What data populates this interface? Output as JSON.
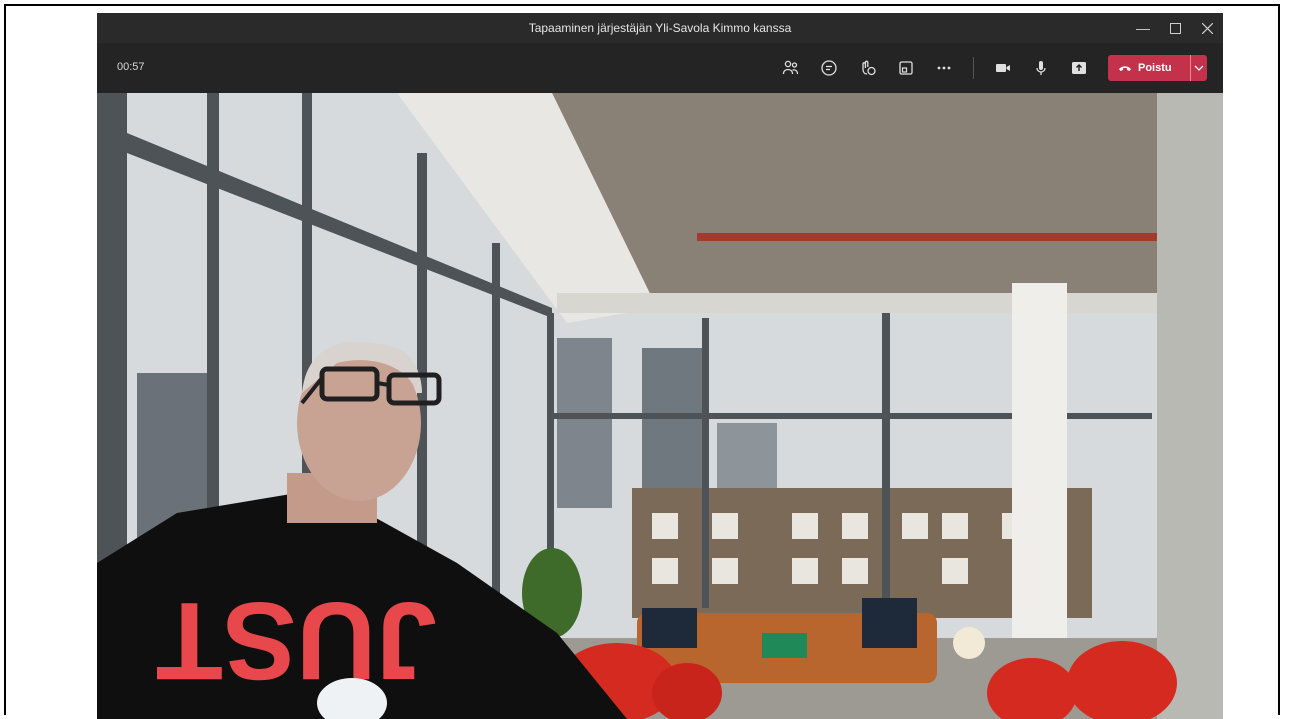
{
  "window": {
    "title": "Tapaaminen järjestäjän Yli-Savola Kimmo kanssa"
  },
  "toolbar": {
    "timer": "00:57",
    "leave_label": "Poistu"
  },
  "icons": {
    "participants": "people-icon",
    "chat": "chat-icon",
    "reactions": "reactions-icon",
    "rooms": "rooms-icon",
    "more": "more-icon",
    "camera": "camera-icon",
    "mic": "microphone-icon",
    "share": "share-icon",
    "hangup": "phone-hangup-icon",
    "dropdown": "chevron-down-icon"
  },
  "colors": {
    "leave": "#c4314b",
    "toolbar": "#242424",
    "titlebar": "#2a2a2a"
  },
  "video": {
    "shirt_text": "JUST"
  }
}
